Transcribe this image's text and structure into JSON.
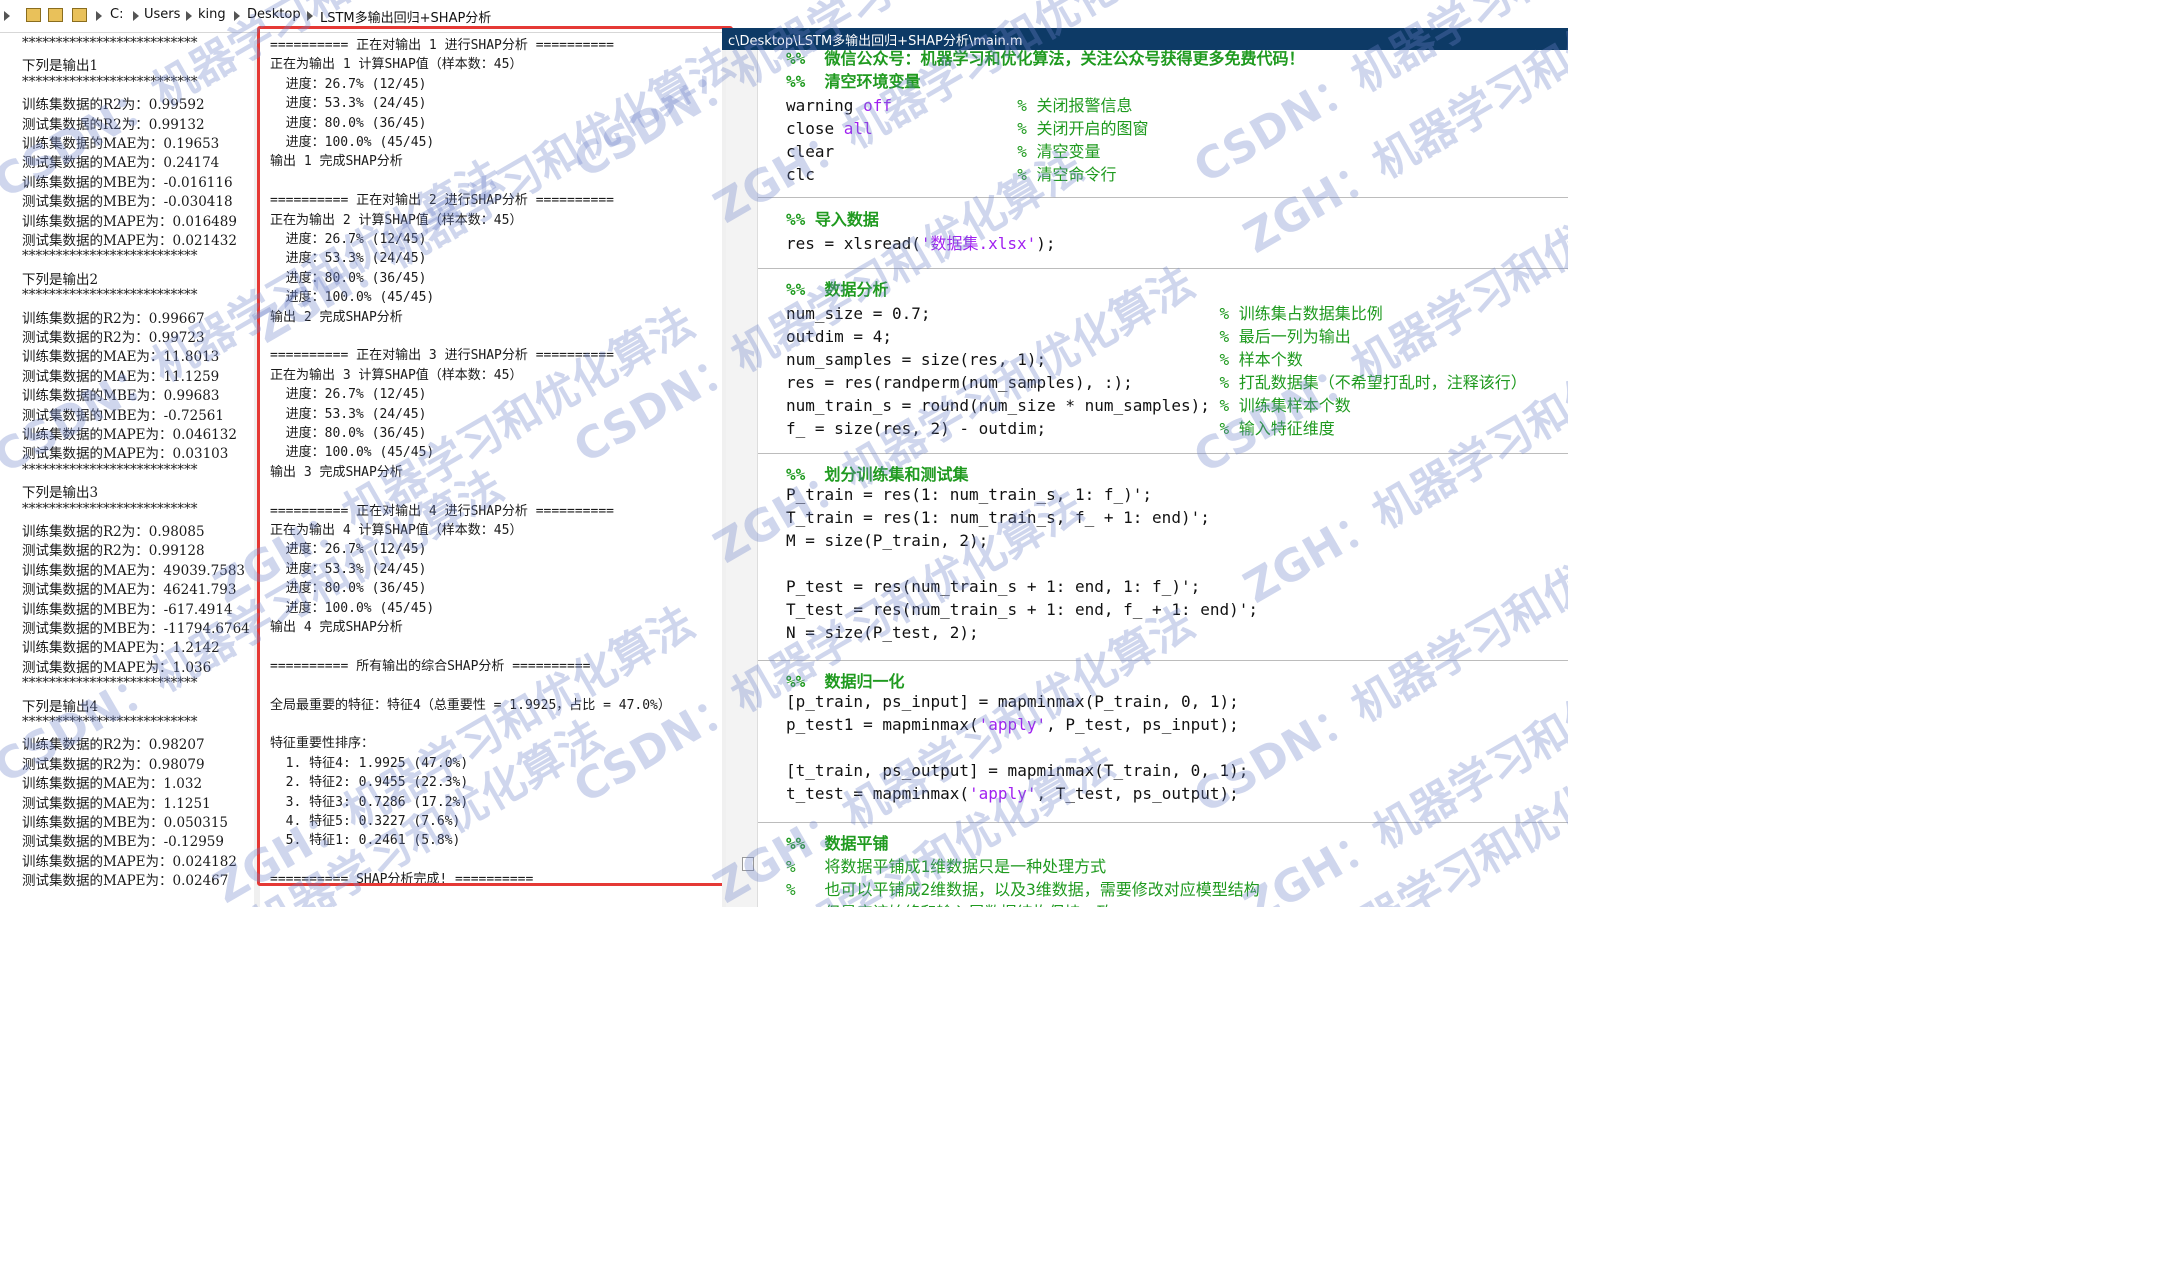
{
  "path_bar": {
    "segments": [
      "C:",
      "Users",
      "king",
      "Desktop",
      "LSTM多输出回归+SHAP分析"
    ]
  },
  "editor": {
    "title": "c\\Desktop\\LSTM多输出回归+SHAP分析\\main.m",
    "lines": [
      {
        "id": "l1",
        "parts": [
          {
            "t": "%%  微信公众号：机器学习和优化算法，关注公众号获得更多免费代码！",
            "c": "sec"
          }
        ]
      },
      {
        "id": "l2",
        "parts": [
          {
            "t": "%%  清空环境变量",
            "c": "sec"
          }
        ]
      },
      {
        "id": "l3",
        "parts": [
          {
            "t": "warning ",
            "c": ""
          },
          {
            "t": "off",
            "c": "kwp"
          },
          {
            "t": "             ",
            "c": ""
          },
          {
            "t": "% 关闭报警信息",
            "c": "cmt"
          }
        ]
      },
      {
        "id": "l4",
        "parts": [
          {
            "t": "close ",
            "c": ""
          },
          {
            "t": "all",
            "c": "kwp"
          },
          {
            "t": "               ",
            "c": ""
          },
          {
            "t": "% 关闭开启的图窗",
            "c": "cmt"
          }
        ]
      },
      {
        "id": "l5",
        "parts": [
          {
            "t": "clear                   ",
            "c": ""
          },
          {
            "t": "% 清空变量",
            "c": "cmt"
          }
        ]
      },
      {
        "id": "l6",
        "parts": [
          {
            "t": "clc                     ",
            "c": ""
          },
          {
            "t": "% 清空命令行",
            "c": "cmt"
          }
        ]
      },
      {
        "id": "l7",
        "parts": [
          {
            "t": "%% 导入数据",
            "c": "sec"
          }
        ]
      },
      {
        "id": "l8",
        "parts": [
          {
            "t": "res = xlsread(",
            "c": ""
          },
          {
            "t": "'数据集.xlsx'",
            "c": "kwp"
          },
          {
            "t": ");",
            "c": ""
          }
        ]
      },
      {
        "id": "l9",
        "parts": [
          {
            "t": "%%  数据分析",
            "c": "sec"
          }
        ]
      },
      {
        "id": "l10",
        "parts": [
          {
            "t": "num_size = 0.7;                              ",
            "c": ""
          },
          {
            "t": "% 训练集占数据集比例",
            "c": "cmt"
          }
        ]
      },
      {
        "id": "l11",
        "parts": [
          {
            "t": "outdim = 4;                                  ",
            "c": ""
          },
          {
            "t": "% 最后一列为输出",
            "c": "cmt"
          }
        ]
      },
      {
        "id": "l12",
        "parts": [
          {
            "t": "num_samples = size(res, 1);                  ",
            "c": ""
          },
          {
            "t": "% 样本个数",
            "c": "cmt"
          }
        ]
      },
      {
        "id": "l13",
        "parts": [
          {
            "t": "res = res(randperm(num_samples), :);         ",
            "c": ""
          },
          {
            "t": "% 打乱数据集（不希望打乱时，注释该行）",
            "c": "cmt"
          }
        ]
      },
      {
        "id": "l14",
        "parts": [
          {
            "t": "num_train_s = round(num_size * num_samples); ",
            "c": ""
          },
          {
            "t": "% 训练集样本个数",
            "c": "cmt"
          }
        ]
      },
      {
        "id": "l15",
        "parts": [
          {
            "t": "f_ = size(res, 2) - outdim;                  ",
            "c": ""
          },
          {
            "t": "% 输入特征维度",
            "c": "cmt"
          }
        ]
      },
      {
        "id": "l16",
        "parts": [
          {
            "t": "%%  划分训练集和测试集",
            "c": "sec"
          }
        ]
      },
      {
        "id": "l17",
        "parts": [
          {
            "t": "P_train = res(1: num_train_s, 1: f_)';",
            "c": ""
          }
        ]
      },
      {
        "id": "l18",
        "parts": [
          {
            "t": "T_train = res(1: num_train_s, f_ + 1: end)';",
            "c": ""
          }
        ]
      },
      {
        "id": "l19",
        "parts": [
          {
            "t": "M = size(P_train, 2);",
            "c": ""
          }
        ]
      },
      {
        "id": "l20",
        "parts": [
          {
            "t": "P_test = res(num_train_s + 1: end, 1: f_)';",
            "c": ""
          }
        ]
      },
      {
        "id": "l21",
        "parts": [
          {
            "t": "T_test = res(num_train_s + 1: end, f_ + 1: end)';",
            "c": ""
          }
        ]
      },
      {
        "id": "l22",
        "parts": [
          {
            "t": "N = size(P_test, 2);",
            "c": ""
          }
        ]
      },
      {
        "id": "l23",
        "parts": [
          {
            "t": "%%  数据归一化",
            "c": "sec"
          }
        ]
      },
      {
        "id": "l24",
        "parts": [
          {
            "t": "[p_train, ps_input] = mapminmax(P_train, 0, 1);",
            "c": ""
          }
        ]
      },
      {
        "id": "l25",
        "parts": [
          {
            "t": "p_test1 = mapminmax(",
            "c": ""
          },
          {
            "t": "'apply'",
            "c": "kwp"
          },
          {
            "t": ", P_test, ps_input);",
            "c": ""
          }
        ]
      },
      {
        "id": "l26",
        "parts": [
          {
            "t": "[t_train, ps_output] = mapminmax(T_train, 0, 1);",
            "c": ""
          }
        ]
      },
      {
        "id": "l27",
        "parts": [
          {
            "t": "t_test = mapminmax(",
            "c": ""
          },
          {
            "t": "'apply'",
            "c": "kwp"
          },
          {
            "t": ", T_test, ps_output);",
            "c": ""
          }
        ]
      },
      {
        "id": "l28",
        "parts": [
          {
            "t": "%%  数据平铺",
            "c": "sec"
          }
        ]
      },
      {
        "id": "l29",
        "parts": [
          {
            "t": "%   将数据平铺成1维数据只是一种处理方式",
            "c": "cmt"
          }
        ]
      },
      {
        "id": "l30",
        "parts": [
          {
            "t": "%   也可以平铺成2维数据，以及3维数据，需要修改对应模型结构",
            "c": "cmt"
          }
        ]
      },
      {
        "id": "l31",
        "parts": [
          {
            "t": "%   但是应该始终和输入层数据结构保持一致",
            "c": "cmt"
          }
        ]
      }
    ]
  },
  "left_output": [
    "**************************",
    "下列是输出1",
    "**************************",
    "训练集数据的R2为：0.99592",
    "测试集数据的R2为：0.99132",
    "训练集数据的MAE为：0.19653",
    "测试集数据的MAE为：0.24174",
    "训练集数据的MBE为：-0.016116",
    "测试集数据的MBE为：-0.030418",
    "训练集数据的MAPE为：0.016489",
    "测试集数据的MAPE为：0.021432",
    "**************************",
    "下列是输出2",
    "**************************",
    "训练集数据的R2为：0.99667",
    "测试集数据的R2为：0.99723",
    "训练集数据的MAE为：11.8013",
    "测试集数据的MAE为：11.1259",
    "训练集数据的MBE为：0.99683",
    "测试集数据的MBE为：-0.72561",
    "训练集数据的MAPE为：0.046132",
    "测试集数据的MAPE为：0.03103",
    "**************************",
    "下列是输出3",
    "**************************",
    "训练集数据的R2为：0.98085",
    "测试集数据的R2为：0.99128",
    "训练集数据的MAE为：49039.7583",
    "测试集数据的MAE为：46241.793",
    "训练集数据的MBE为：-617.4914",
    "测试集数据的MBE为：-11794.6764",
    "训练集数据的MAPE为：1.2142",
    "测试集数据的MAPE为：1.036",
    "**************************",
    "下列是输出4",
    "**************************",
    "训练集数据的R2为：0.98207",
    "测试集数据的R2为：0.98079",
    "训练集数据的MAE为：1.032",
    "测试集数据的MAE为：1.1251",
    "训练集数据的MBE为：0.050315",
    "测试集数据的MBE为：-0.12959",
    "训练集数据的MAPE为：0.024182",
    "测试集数据的MAPE为：0.02467"
  ],
  "command_output": [
    {
      "id": "c1",
      "t": "========== 正在对输出 1 进行SHAP分析 =========="
    },
    {
      "id": "c2",
      "t": "正在为输出 1 计算SHAP值（样本数：45）"
    },
    {
      "id": "c3",
      "t": "  进度：26.7% (12/45)"
    },
    {
      "id": "c4",
      "t": "  进度：53.3% (24/45)"
    },
    {
      "id": "c5",
      "t": "  进度：80.0% (36/45)"
    },
    {
      "id": "c6",
      "t": "  进度：100.0% (45/45)"
    },
    {
      "id": "c7",
      "t": "输出 1 完成SHAP分析"
    },
    {
      "id": "c8",
      "t": "========== 正在对输出 2 进行SHAP分析 =========="
    },
    {
      "id": "c9",
      "t": "正在为输出 2 计算SHAP值（样本数：45）"
    },
    {
      "id": "c10",
      "t": "  进度：26.7% (12/45)"
    },
    {
      "id": "c11",
      "t": "  进度：53.3% (24/45)"
    },
    {
      "id": "c12",
      "t": "  进度：80.0% (36/45)"
    },
    {
      "id": "c13",
      "t": "  进度：100.0% (45/45)"
    },
    {
      "id": "c14",
      "t": "输出 2 完成SHAP分析"
    },
    {
      "id": "c15",
      "t": "========== 正在对输出 3 进行SHAP分析 =========="
    },
    {
      "id": "c16",
      "t": "正在为输出 3 计算SHAP值（样本数：45）"
    },
    {
      "id": "c17",
      "t": "  进度：26.7% (12/45)"
    },
    {
      "id": "c18",
      "t": "  进度：53.3% (24/45)"
    },
    {
      "id": "c19",
      "t": "  进度：80.0% (36/45)"
    },
    {
      "id": "c20",
      "t": "  进度：100.0% (45/45)"
    },
    {
      "id": "c21",
      "t": "输出 3 完成SHAP分析"
    },
    {
      "id": "c22",
      "t": "========== 正在对输出 4 进行SHAP分析 =========="
    },
    {
      "id": "c23",
      "t": "正在为输出 4 计算SHAP值（样本数：45）"
    },
    {
      "id": "c24",
      "t": "  进度：26.7% (12/45)"
    },
    {
      "id": "c25",
      "t": "  进度：53.3% (24/45)"
    },
    {
      "id": "c26",
      "t": "  进度：80.0% (36/45)"
    },
    {
      "id": "c27",
      "t": "  进度：100.0% (45/45)"
    },
    {
      "id": "c28",
      "t": "输出 4 完成SHAP分析"
    },
    {
      "id": "c29",
      "t": "========== 所有输出的综合SHAP分析 =========="
    },
    {
      "id": "c30",
      "t": "全局最重要的特征：特征4（总重要性 = 1.9925，占比 = 47.0%）"
    },
    {
      "id": "c31",
      "t": "特征重要性排序："
    },
    {
      "id": "c32",
      "t": "  1. 特征4: 1.9925 (47.0%)"
    },
    {
      "id": "c33",
      "t": "  2. 特征2: 0.9455 (22.3%)"
    },
    {
      "id": "c34",
      "t": "  3. 特征3: 0.7286 (17.2%)"
    },
    {
      "id": "c35",
      "t": "  4. 特征5: 0.3227 (7.6%)"
    },
    {
      "id": "c36",
      "t": "  5. 特征1: 0.2461 (5.8%)"
    },
    {
      "id": "c37",
      "t": "========== SHAP分析完成! =========="
    }
  ],
  "watermark": {
    "phrases": [
      "CSDN：机器学习和优化算法",
      "ZGH：机器学习和优化算法"
    ]
  },
  "colors": {
    "highlight_box": "#e53935",
    "comment": "#1f9a1f",
    "string": "#a020f0",
    "title_bar": "#0d3a66"
  }
}
